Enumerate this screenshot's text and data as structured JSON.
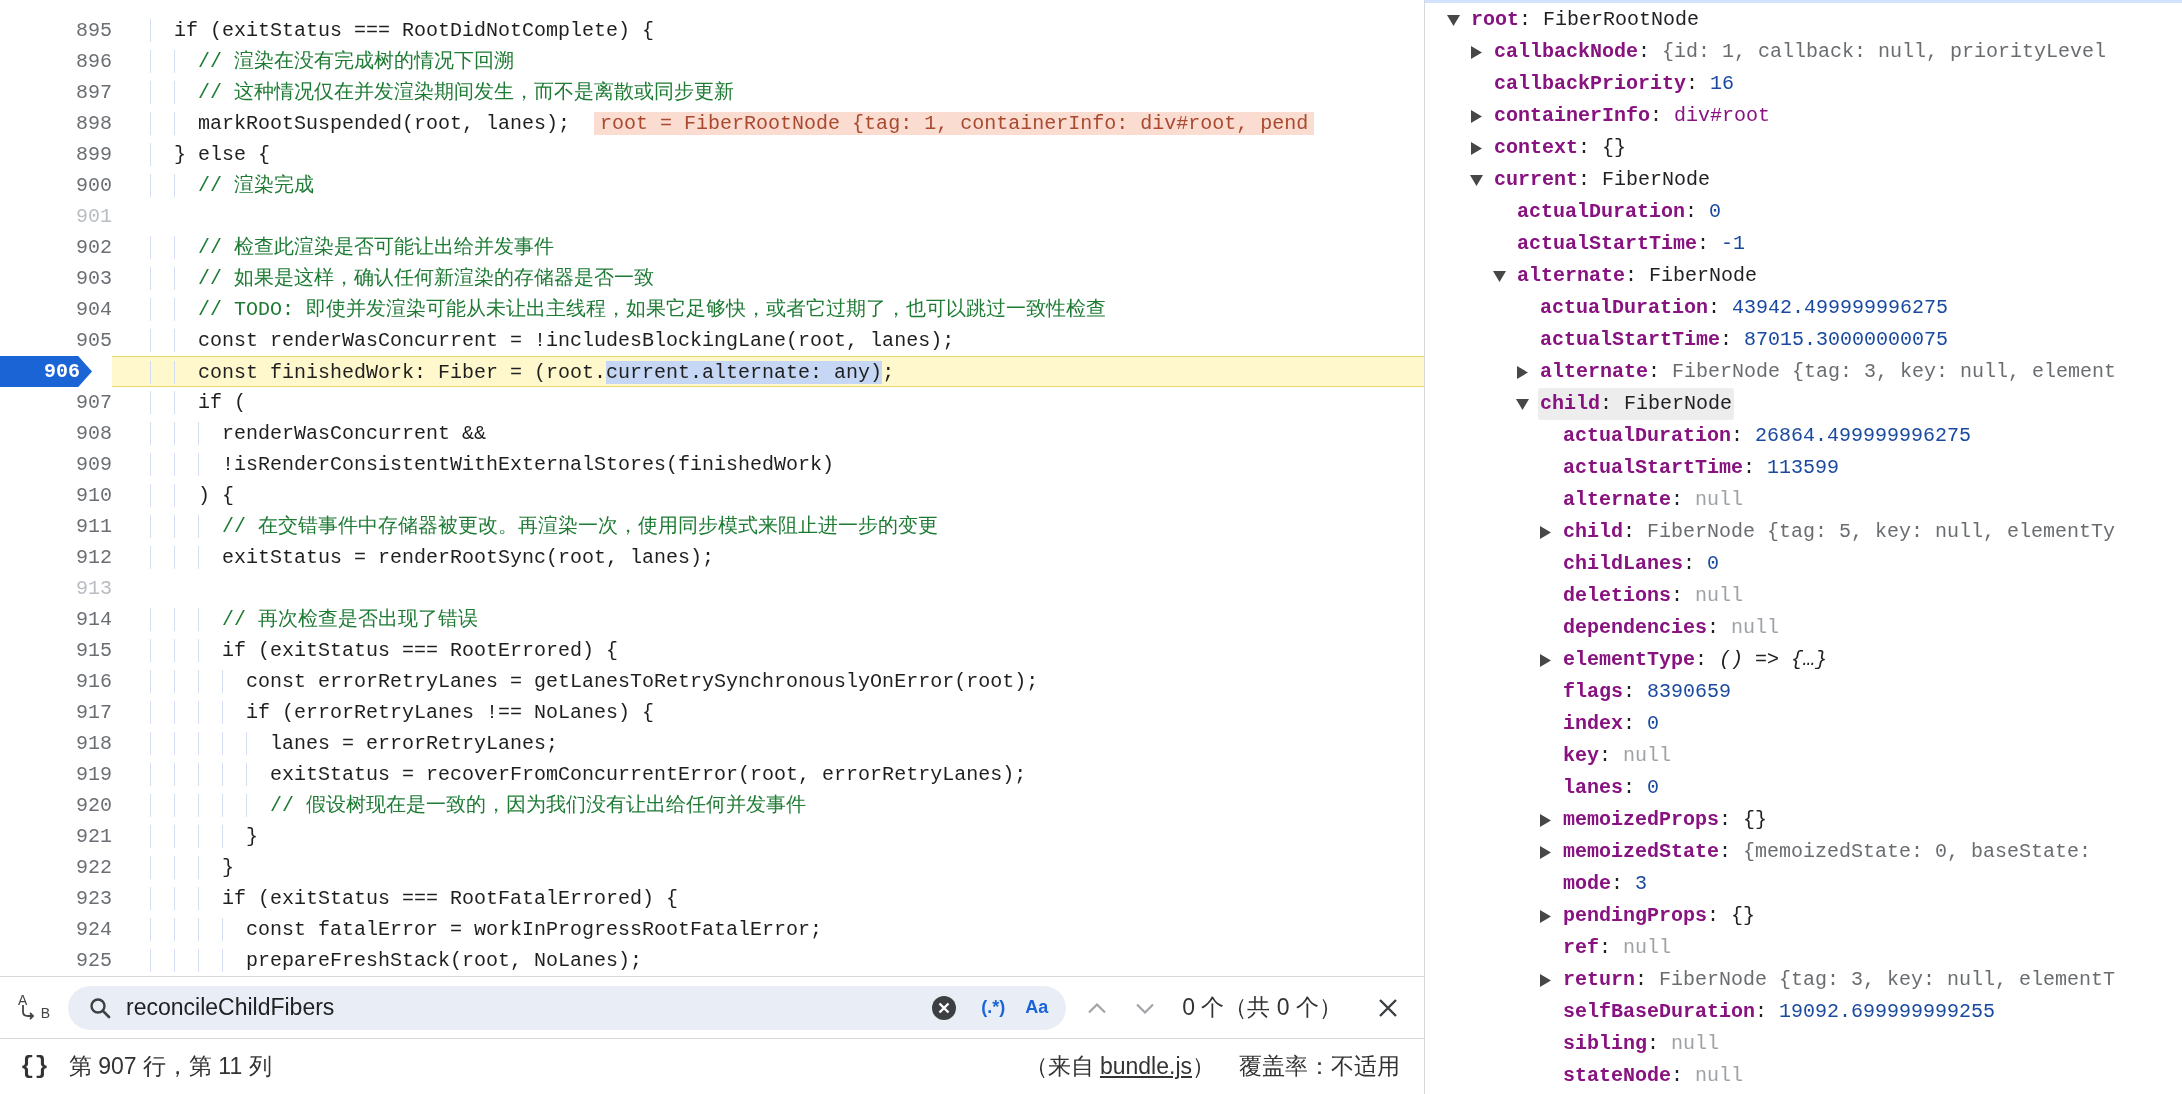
{
  "code_editor": {
    "lines": [
      {
        "number": "895",
        "kind": "code",
        "paused": false,
        "text": "    if (exitStatus === RootDidNotComplete) {"
      },
      {
        "number": "896",
        "kind": "comment",
        "paused": false,
        "text": "      // 渲染在没有完成树的情况下回溯"
      },
      {
        "number": "897",
        "kind": "comment",
        "paused": false,
        "text": "      // 这种情况仅在并发渲染期间发生，而不是离散或同步更新"
      },
      {
        "number": "898",
        "kind": "code",
        "paused": false,
        "text": "      markRootSuspended(root, lanes);",
        "inline_value": "root = FiberRootNode {tag: 1, containerInfo: div#root, pend"
      },
      {
        "number": "899",
        "kind": "code",
        "paused": false,
        "text": "    } else {"
      },
      {
        "number": "900",
        "kind": "comment",
        "paused": false,
        "text": "      // 渲染完成"
      },
      {
        "number": "901",
        "kind": "blank",
        "paused": false
      },
      {
        "number": "902",
        "kind": "comment",
        "paused": false,
        "text": "      // 检查此渲染是否可能让出给并发事件"
      },
      {
        "number": "903",
        "kind": "comment",
        "paused": false,
        "text": "      // 如果是这样，确认任何新渲染的存储器是否一致"
      },
      {
        "number": "904",
        "kind": "comment",
        "paused": false,
        "text": "      // TODO: 即使并发渲染可能从未让出主线程，如果它足够快，或者它过期了，也可以跳过一致性检查"
      },
      {
        "number": "905",
        "kind": "code",
        "paused": false,
        "text": "      const renderWasConcurrent = !includesBlockingLane(root, lanes);"
      },
      {
        "number": "906",
        "kind": "code",
        "paused": true,
        "parts": [
          {
            "text": "      const finishedWork: Fiber = (root.",
            "selected": false
          },
          {
            "text": "current.alternate: any)",
            "selected": true
          },
          {
            "text": ";",
            "selected": false
          }
        ]
      },
      {
        "number": "907",
        "kind": "code",
        "paused": false,
        "text": "      if ("
      },
      {
        "number": "908",
        "kind": "code",
        "paused": false,
        "text": "        renderWasConcurrent &&"
      },
      {
        "number": "909",
        "kind": "code",
        "paused": false,
        "text": "        !isRenderConsistentWithExternalStores(finishedWork)"
      },
      {
        "number": "910",
        "kind": "code",
        "paused": false,
        "text": "      ) {"
      },
      {
        "number": "911",
        "kind": "comment",
        "paused": false,
        "text": "        // 在交错事件中存储器被更改。再渲染一次，使用同步模式来阻止进一步的变更"
      },
      {
        "number": "912",
        "kind": "code",
        "paused": false,
        "text": "        exitStatus = renderRootSync(root, lanes);"
      },
      {
        "number": "913",
        "kind": "blank",
        "paused": false
      },
      {
        "number": "914",
        "kind": "comment",
        "paused": false,
        "text": "        // 再次检查是否出现了错误"
      },
      {
        "number": "915",
        "kind": "code",
        "paused": false,
        "text": "        if (exitStatus === RootErrored) {"
      },
      {
        "number": "916",
        "kind": "code",
        "paused": false,
        "text": "          const errorRetryLanes = getLanesToRetrySynchronouslyOnError(root);"
      },
      {
        "number": "917",
        "kind": "code",
        "paused": false,
        "text": "          if (errorRetryLanes !== NoLanes) {"
      },
      {
        "number": "918",
        "kind": "code",
        "paused": false,
        "text": "            lanes = errorRetryLanes;"
      },
      {
        "number": "919",
        "kind": "code",
        "paused": false,
        "text": "            exitStatus = recoverFromConcurrentError(root, errorRetryLanes);"
      },
      {
        "number": "920",
        "kind": "comment",
        "paused": false,
        "text": "            // 假设树现在是一致的，因为我们没有让出给任何并发事件"
      },
      {
        "number": "921",
        "kind": "code",
        "paused": false,
        "text": "          }"
      },
      {
        "number": "922",
        "kind": "code",
        "paused": false,
        "text": "        }"
      },
      {
        "number": "923",
        "kind": "code",
        "paused": false,
        "text": "        if (exitStatus === RootFatalErrored) {"
      },
      {
        "number": "924",
        "kind": "code",
        "paused": false,
        "text": "          const fatalError = workInProgressRootFatalError;"
      },
      {
        "number": "925",
        "kind": "code",
        "paused": false,
        "text": "          prepareFreshStack(root, NoLanes);"
      }
    ]
  },
  "search_bar": {
    "replace_toggle": {
      "top": "A",
      "bottom": "B"
    },
    "value": "reconcileChildFibers",
    "regex_button": "(.*)",
    "case_button": "Aa",
    "nav_buttons": [
      {
        "kind": "up",
        "disabled": true
      },
      {
        "kind": "down",
        "disabled": true
      }
    ],
    "match_count": "0 个（共 0 个）"
  },
  "status_bar": {
    "format_button": "{}",
    "position": "第 907 行，第 11 列",
    "source": {
      "prefix": "（来自 ",
      "link": "bundle.js",
      "suffix": "）"
    },
    "coverage": "覆盖率：不适用"
  },
  "scope_tree": {
    "items": [
      {
        "key": "root",
        "separator": ":",
        "value": "FiberRootNode",
        "kind": "object",
        "expanded": true,
        "hovered": false,
        "children": [
          {
            "key": "callbackNode",
            "separator": ":",
            "value": "{id: 1, callback: null, priorityLevel",
            "kind": "preview",
            "expanded": false,
            "hovered": false
          },
          {
            "key": "callbackPriority",
            "separator": ":",
            "value": "16",
            "kind": "number",
            "hovered": false
          },
          {
            "key": "containerInfo",
            "separator": ":",
            "value": "div#root",
            "kind": "node",
            "expanded": false,
            "hovered": false
          },
          {
            "key": "context",
            "separator": ":",
            "value": "{}",
            "kind": "object",
            "expanded": false,
            "hovered": false
          },
          {
            "key": "current",
            "separator": ":",
            "value": "FiberNode",
            "kind": "object",
            "expanded": true,
            "hovered": false,
            "children": [
              {
                "key": "actualDuration",
                "separator": ":",
                "value": "0",
                "kind": "number",
                "hovered": false
              },
              {
                "key": "actualStartTime",
                "separator": ":",
                "value": "-1",
                "kind": "number",
                "hovered": false
              },
              {
                "key": "alternate",
                "separator": ":",
                "value": "FiberNode",
                "kind": "object",
                "expanded": true,
                "hovered": false,
                "children": [
                  {
                    "key": "actualDuration",
                    "separator": ":",
                    "value": "43942.499999996275",
                    "kind": "number",
                    "hovered": false
                  },
                  {
                    "key": "actualStartTime",
                    "separator": ":",
                    "value": "87015.30000000075",
                    "kind": "number",
                    "hovered": false
                  },
                  {
                    "key": "alternate",
                    "separator": ":",
                    "value": "FiberNode {tag: 3, key: null, element",
                    "kind": "preview",
                    "expanded": false,
                    "hovered": false
                  },
                  {
                    "key": "child",
                    "separator": ":",
                    "value": "FiberNode",
                    "kind": "object",
                    "expanded": true,
                    "hovered": true,
                    "children": [
                      {
                        "key": "actualDuration",
                        "separator": ":",
                        "value": "26864.499999996275",
                        "kind": "number",
                        "hovered": false
                      },
                      {
                        "key": "actualStartTime",
                        "separator": ":",
                        "value": "113599",
                        "kind": "number",
                        "hovered": false
                      },
                      {
                        "key": "alternate",
                        "separator": ":",
                        "value": "null",
                        "kind": "null",
                        "hovered": false
                      },
                      {
                        "key": "child",
                        "separator": ":",
                        "value": "FiberNode {tag: 5, key: null, elementTy",
                        "kind": "preview",
                        "expanded": false,
                        "hovered": false
                      },
                      {
                        "key": "childLanes",
                        "separator": ":",
                        "value": "0",
                        "kind": "number",
                        "hovered": false
                      },
                      {
                        "key": "deletions",
                        "separator": ":",
                        "value": "null",
                        "kind": "null",
                        "hovered": false
                      },
                      {
                        "key": "dependencies",
                        "separator": ":",
                        "value": "null",
                        "kind": "null",
                        "hovered": false
                      },
                      {
                        "key": "elementType",
                        "separator": ":",
                        "value": "() => {…}",
                        "kind": "function",
                        "expanded": false,
                        "hovered": false
                      },
                      {
                        "key": "flags",
                        "separator": ":",
                        "value": "8390659",
                        "kind": "number",
                        "hovered": false
                      },
                      {
                        "key": "index",
                        "separator": ":",
                        "value": "0",
                        "kind": "number",
                        "hovered": false
                      },
                      {
                        "key": "key",
                        "separator": ":",
                        "value": "null",
                        "kind": "null",
                        "hovered": false
                      },
                      {
                        "key": "lanes",
                        "separator": ":",
                        "value": "0",
                        "kind": "number",
                        "hovered": false
                      },
                      {
                        "key": "memoizedProps",
                        "separator": ":",
                        "value": "{}",
                        "kind": "object",
                        "expanded": false,
                        "hovered": false
                      },
                      {
                        "key": "memoizedState",
                        "separator": ":",
                        "value": "{memoizedState: 0, baseState:",
                        "kind": "preview",
                        "expanded": false,
                        "hovered": false
                      },
                      {
                        "key": "mode",
                        "separator": ":",
                        "value": "3",
                        "kind": "number",
                        "hovered": false
                      },
                      {
                        "key": "pendingProps",
                        "separator": ":",
                        "value": "{}",
                        "kind": "object",
                        "expanded": false,
                        "hovered": false
                      },
                      {
                        "key": "ref",
                        "separator": ":",
                        "value": "null",
                        "kind": "null",
                        "hovered": false
                      },
                      {
                        "key": "return",
                        "separator": ":",
                        "value": "FiberNode {tag: 3, key: null, elementT",
                        "kind": "preview",
                        "expanded": false,
                        "hovered": false
                      },
                      {
                        "key": "selfBaseDuration",
                        "separator": ":",
                        "value": "19092.699999999255",
                        "kind": "number",
                        "hovered": false
                      },
                      {
                        "key": "sibling",
                        "separator": ":",
                        "value": "null",
                        "kind": "null",
                        "hovered": false
                      },
                      {
                        "key": "stateNode",
                        "separator": ":",
                        "value": "null",
                        "kind": "null",
                        "hovered": false
                      }
                    ]
                  }
                ]
              }
            ]
          }
        ]
      }
    ]
  }
}
